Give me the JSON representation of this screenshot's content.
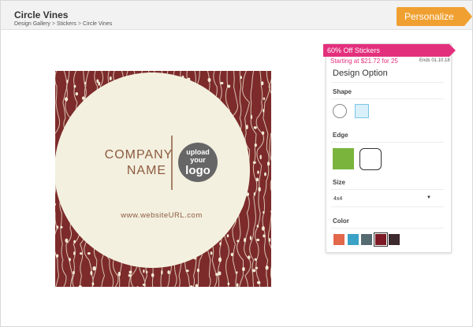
{
  "header": {
    "title": "Circle Vines",
    "breadcrumb": [
      "Design Gallery",
      "Stickers",
      "Circle Vines"
    ],
    "breadcrumb_separator": ">",
    "personalize_label": "Personalize"
  },
  "preview": {
    "company_line1": "COMPANY",
    "company_line2": "NAME",
    "logo_lines": [
      "upload",
      "your",
      "logo"
    ],
    "website": "www.websiteURL.com"
  },
  "panel": {
    "promo_title": "60% Off Stickers",
    "promo_sub": "Starting at $21.72 for 25",
    "promo_ends": "Ends 01.10.18",
    "heading": "Design Option",
    "shape_label": "Shape",
    "shapes": [
      "circle-icon",
      "square-icon"
    ],
    "edge_label": "Edge",
    "edges": [
      "square-edge",
      "rounded-edge"
    ],
    "size_label": "Size",
    "size_value": "4x4",
    "color_label": "Color",
    "colors": [
      "#e2674b",
      "#3aa2c6",
      "#566a72",
      "#7b1a24",
      "#3c2a2f"
    ],
    "selected_color_index": 3
  },
  "colors": {
    "accent_orange": "#f0a030",
    "promo_pink": "#e3307d",
    "pattern_bg": "#7c2b2a",
    "circle_cream": "#f3f0df",
    "company_brown": "#8d5a3f",
    "edge_green": "#7ab43d"
  }
}
